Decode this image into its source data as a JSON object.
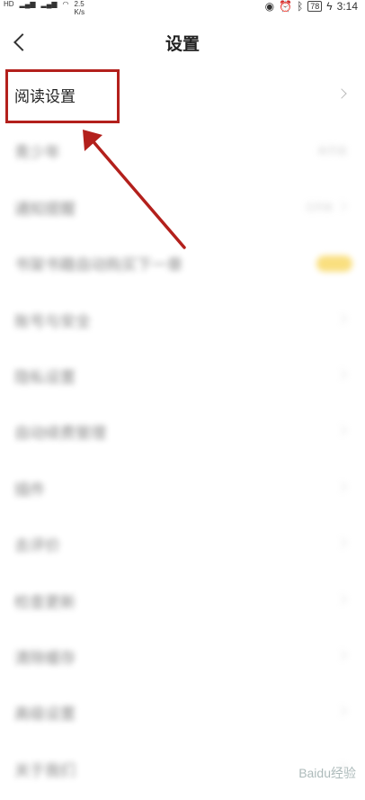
{
  "status_bar": {
    "hd_badge": "HD",
    "net_speed": "2.5\nK/s",
    "battery": "78",
    "time": "3:14"
  },
  "header": {
    "title": "设置"
  },
  "settings": [
    {
      "label": "阅读设置",
      "accessory": "chevron"
    },
    {
      "label": "青少年",
      "accessory": "value",
      "value": "未开启"
    },
    {
      "label": "通知提醒",
      "accessory": "value-chevron",
      "value": "已开启"
    },
    {
      "label": "书架书籍自动购买下一章",
      "accessory": "toggle"
    },
    {
      "label": "账号与安全",
      "accessory": "chevron"
    },
    {
      "label": "隐私设置",
      "accessory": "chevron"
    },
    {
      "label": "自动续费管理",
      "accessory": "chevron"
    },
    {
      "label": "插件",
      "accessory": "chevron"
    },
    {
      "label": "去评价",
      "accessory": "chevron"
    },
    {
      "label": "检查更新",
      "accessory": "chevron"
    },
    {
      "label": "清除缓存",
      "accessory": "chevron"
    },
    {
      "label": "高级设置",
      "accessory": "chevron"
    },
    {
      "label": "关于我们",
      "accessory": "chevron"
    }
  ],
  "annotation": {
    "color": "#b3201c"
  },
  "watermark": "Baidu经验"
}
